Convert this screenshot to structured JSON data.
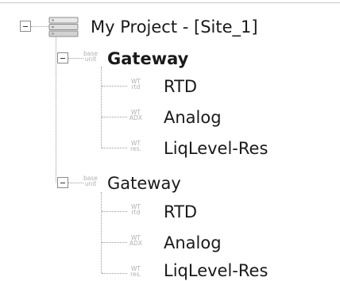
{
  "tree": {
    "root": {
      "label": "My Project - [Site_1]",
      "icon": "server-stack-icon"
    },
    "gateways": [
      {
        "label": "Gateway",
        "bold": true,
        "icon_top": "base",
        "icon_bottom": "unit",
        "children": [
          {
            "label": "RTD",
            "icon_top": "WT",
            "icon_bottom": "rtd"
          },
          {
            "label": "Analog",
            "icon_top": "WT",
            "icon_bottom": "ADX"
          },
          {
            "label": "LiqLevel-Res",
            "icon_top": "WT",
            "icon_bottom": "res."
          }
        ]
      },
      {
        "label": "Gateway",
        "bold": false,
        "icon_top": "base",
        "icon_bottom": "unit",
        "children": [
          {
            "label": "RTD",
            "icon_top": "WT",
            "icon_bottom": "rtd"
          },
          {
            "label": "Analog",
            "icon_top": "WT",
            "icon_bottom": "ADX"
          },
          {
            "label": "LiqLevel-Res",
            "icon_top": "WT",
            "icon_bottom": "res."
          }
        ]
      }
    ]
  }
}
